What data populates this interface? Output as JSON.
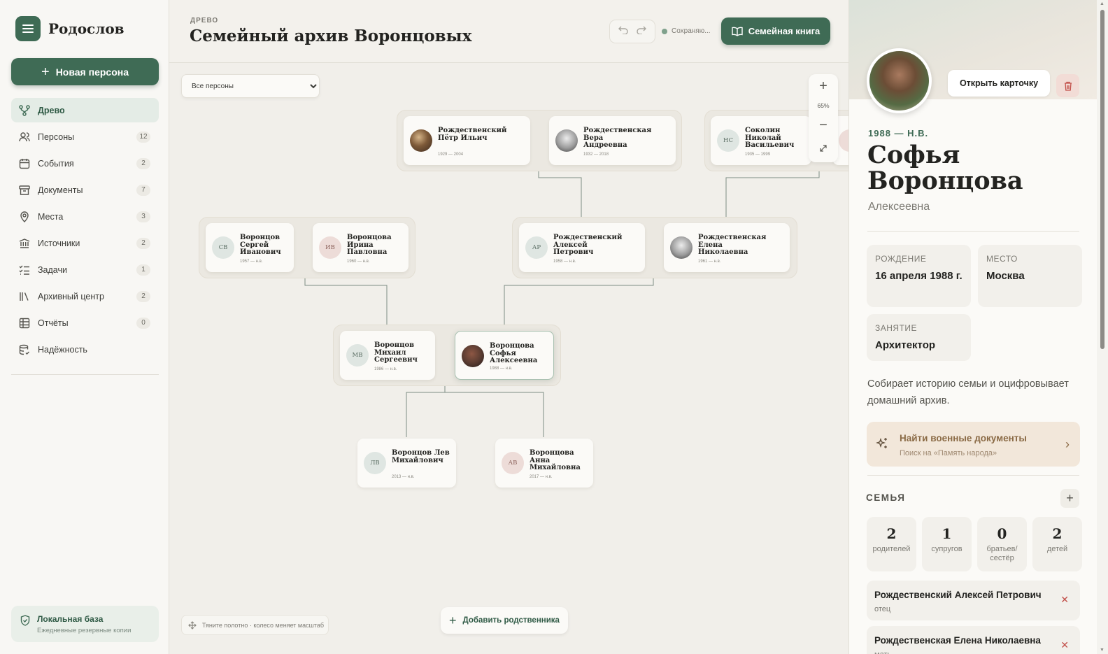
{
  "app": {
    "title": "Родослов"
  },
  "sidebar": {
    "new_person": "Новая персона",
    "items": [
      {
        "label": "Древо",
        "count": "",
        "icon": "tree-icon",
        "active": true
      },
      {
        "label": "Персоны",
        "count": "12",
        "icon": "users-icon"
      },
      {
        "label": "События",
        "count": "2",
        "icon": "calendar-icon"
      },
      {
        "label": "Документы",
        "count": "7",
        "icon": "archive-box-icon"
      },
      {
        "label": "Места",
        "count": "3",
        "icon": "map-pin-icon"
      },
      {
        "label": "Источники",
        "count": "2",
        "icon": "landmark-icon"
      },
      {
        "label": "Задачи",
        "count": "1",
        "icon": "checklist-icon"
      },
      {
        "label": "Архивный центр",
        "count": "2",
        "icon": "library-icon"
      },
      {
        "label": "Отчёты",
        "count": "0",
        "icon": "table-icon"
      },
      {
        "label": "Надёжность",
        "count": "",
        "icon": "database-check-icon"
      }
    ],
    "local_base": {
      "title": "Локальная база",
      "subtitle": "Ежедневные резервные копии"
    }
  },
  "header": {
    "crumb": "ДРЕВО",
    "title": "Семейный архив Воронцовых",
    "save_status": "Сохраняю...",
    "family_book": "Семейная книга"
  },
  "canvas": {
    "filter": {
      "selected": "Все персоны"
    },
    "zoom": {
      "plus": "+",
      "level": "65%",
      "minus": "−"
    },
    "hint": "Тяните полотно · колесо меняет масштаб",
    "add_relative": "Добавить родственника",
    "persons": [
      {
        "id": "p1",
        "name": "Рождественский Пётр Ильич",
        "dates": "1929 — 2004",
        "initials": "",
        "gender": "photo"
      },
      {
        "id": "p2",
        "name": "Рождественская Вера Андреевна",
        "dates": "1932 — 2018",
        "initials": "",
        "gender": "photo2"
      },
      {
        "id": "p3",
        "name": "Соколин Николай Васильевич",
        "dates": "1935 — 1999",
        "initials": "НС",
        "gender": "m"
      },
      {
        "id": "p4",
        "name": "Воронцов Сергей Иванович",
        "dates": "1957 — н.в.",
        "initials": "СВ",
        "gender": "m"
      },
      {
        "id": "p5",
        "name": "Воронцова Ирина Павловна",
        "dates": "1960 — н.в.",
        "initials": "ИВ",
        "gender": "f"
      },
      {
        "id": "p6",
        "name": "Рождественский Алексей Петрович",
        "dates": "1958 — н.в.",
        "initials": "АР",
        "gender": "m"
      },
      {
        "id": "p7",
        "name": "Рождественская Елена Николаевна",
        "dates": "1961 — н.в.",
        "initials": "",
        "gender": "photo2"
      },
      {
        "id": "p8",
        "name": "Воронцов Михаил Сергеевич",
        "dates": "1986 — н.в.",
        "initials": "МВ",
        "gender": "m"
      },
      {
        "id": "p9",
        "name": "Воронцова Софья Алексеевна",
        "dates": "1988 — н.в.",
        "initials": "",
        "gender": "photo3"
      },
      {
        "id": "p10",
        "name": "Воронцов Лев Михайлович",
        "dates": "2013 — н.в.",
        "initials": "ЛВ",
        "gender": "m"
      },
      {
        "id": "p11",
        "name": "Воронцова Анна Михайловна",
        "dates": "2017 — н.в.",
        "initials": "АВ",
        "gender": "f"
      }
    ]
  },
  "panel": {
    "open_card": "Открыть карточку",
    "years": "1988 — Н.В.",
    "name": "Софья Воронцова",
    "patronymic": "Алексеевна",
    "facts": [
      {
        "label": "РОЖДЕНИЕ",
        "value": "16 апреля 1988 г."
      },
      {
        "label": "МЕСТО",
        "value": "Москва"
      },
      {
        "label": "ЗАНЯТИЕ",
        "value": "Архитектор"
      }
    ],
    "bio": "Собирает историю семьи и оцифровывает домашний архив.",
    "war_docs": {
      "title": "Найти военные документы",
      "subtitle": "Поиск на «Память народа»"
    },
    "family": {
      "title": "СЕМЬЯ",
      "stats": [
        {
          "value": "2",
          "label": "родителей"
        },
        {
          "value": "1",
          "label": "супругов"
        },
        {
          "value": "0",
          "label": "братьев/ сестёр"
        },
        {
          "value": "2",
          "label": "детей"
        }
      ],
      "relatives": [
        {
          "name": "Рождественский Алексей Петрович",
          "role": "отец"
        },
        {
          "name": "Рождественская Елена Николаевна",
          "role": "мать"
        }
      ]
    }
  },
  "colors": {
    "accent": "#3f6b55",
    "connector": "#b98a55",
    "danger": "#c2504a"
  }
}
